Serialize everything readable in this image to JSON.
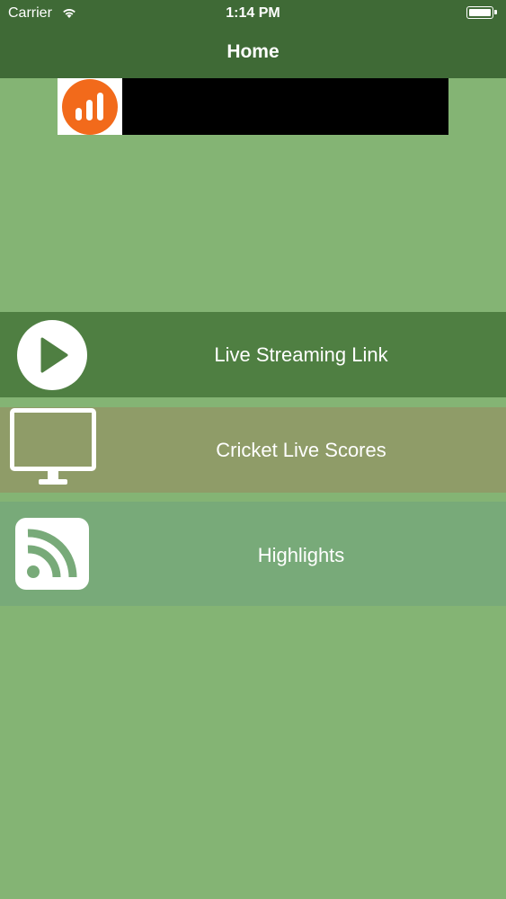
{
  "status_bar": {
    "carrier": "Carrier",
    "time": "1:14 PM"
  },
  "nav": {
    "title": "Home"
  },
  "menu": [
    {
      "label": "Live Streaming Link",
      "icon": "play-circle-icon",
      "color": "#4f7f42"
    },
    {
      "label": "Cricket Live Scores",
      "icon": "monitor-icon",
      "color": "#8f9c68"
    },
    {
      "label": "Highlights",
      "icon": "rss-icon",
      "color": "#78aa79"
    }
  ],
  "colors": {
    "background": "#84b474",
    "nav": "#3f6a36",
    "banner_logo": "#f26a1b"
  }
}
